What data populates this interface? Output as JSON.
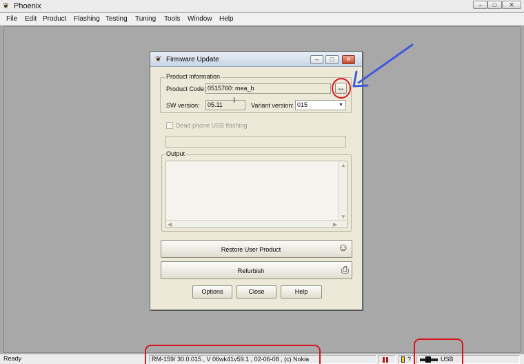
{
  "window": {
    "title": "Phoenix",
    "minimize_glyph": "–",
    "maximize_glyph": "□",
    "close_glyph": "✕"
  },
  "menu": [
    "File",
    "Edit",
    "Product",
    "Flashing",
    "Testing",
    "Tuning",
    "Tools",
    "Window",
    "Help"
  ],
  "dialog": {
    "title": "Firmware Update",
    "product_info": {
      "legend": "Product information",
      "product_code_label": "Product Code:",
      "product_code_value": "0515760: mea_b",
      "browse_label": "...",
      "sw_version_label": "SW version:",
      "sw_version_value": "05.11",
      "variant_version_label": "Variant version:",
      "variant_version_value": "015"
    },
    "dead_phone_label": "Dead phone USB flashing",
    "output_legend": "Output",
    "restore_button": "Restore User Product",
    "refurbish_button": "Refurbish",
    "options_button": "Options",
    "close_button": "Close",
    "help_button": "Help"
  },
  "statusbar": {
    "ready": "Ready",
    "product_info": "RM-159/ 30.0.015 , V 06wk41v59.1 , 02-06-08 , (c) Nokia",
    "connection": "USB"
  },
  "annotation_colors": {
    "ring": "#d8141c",
    "arrow": "#3f5bdc"
  }
}
